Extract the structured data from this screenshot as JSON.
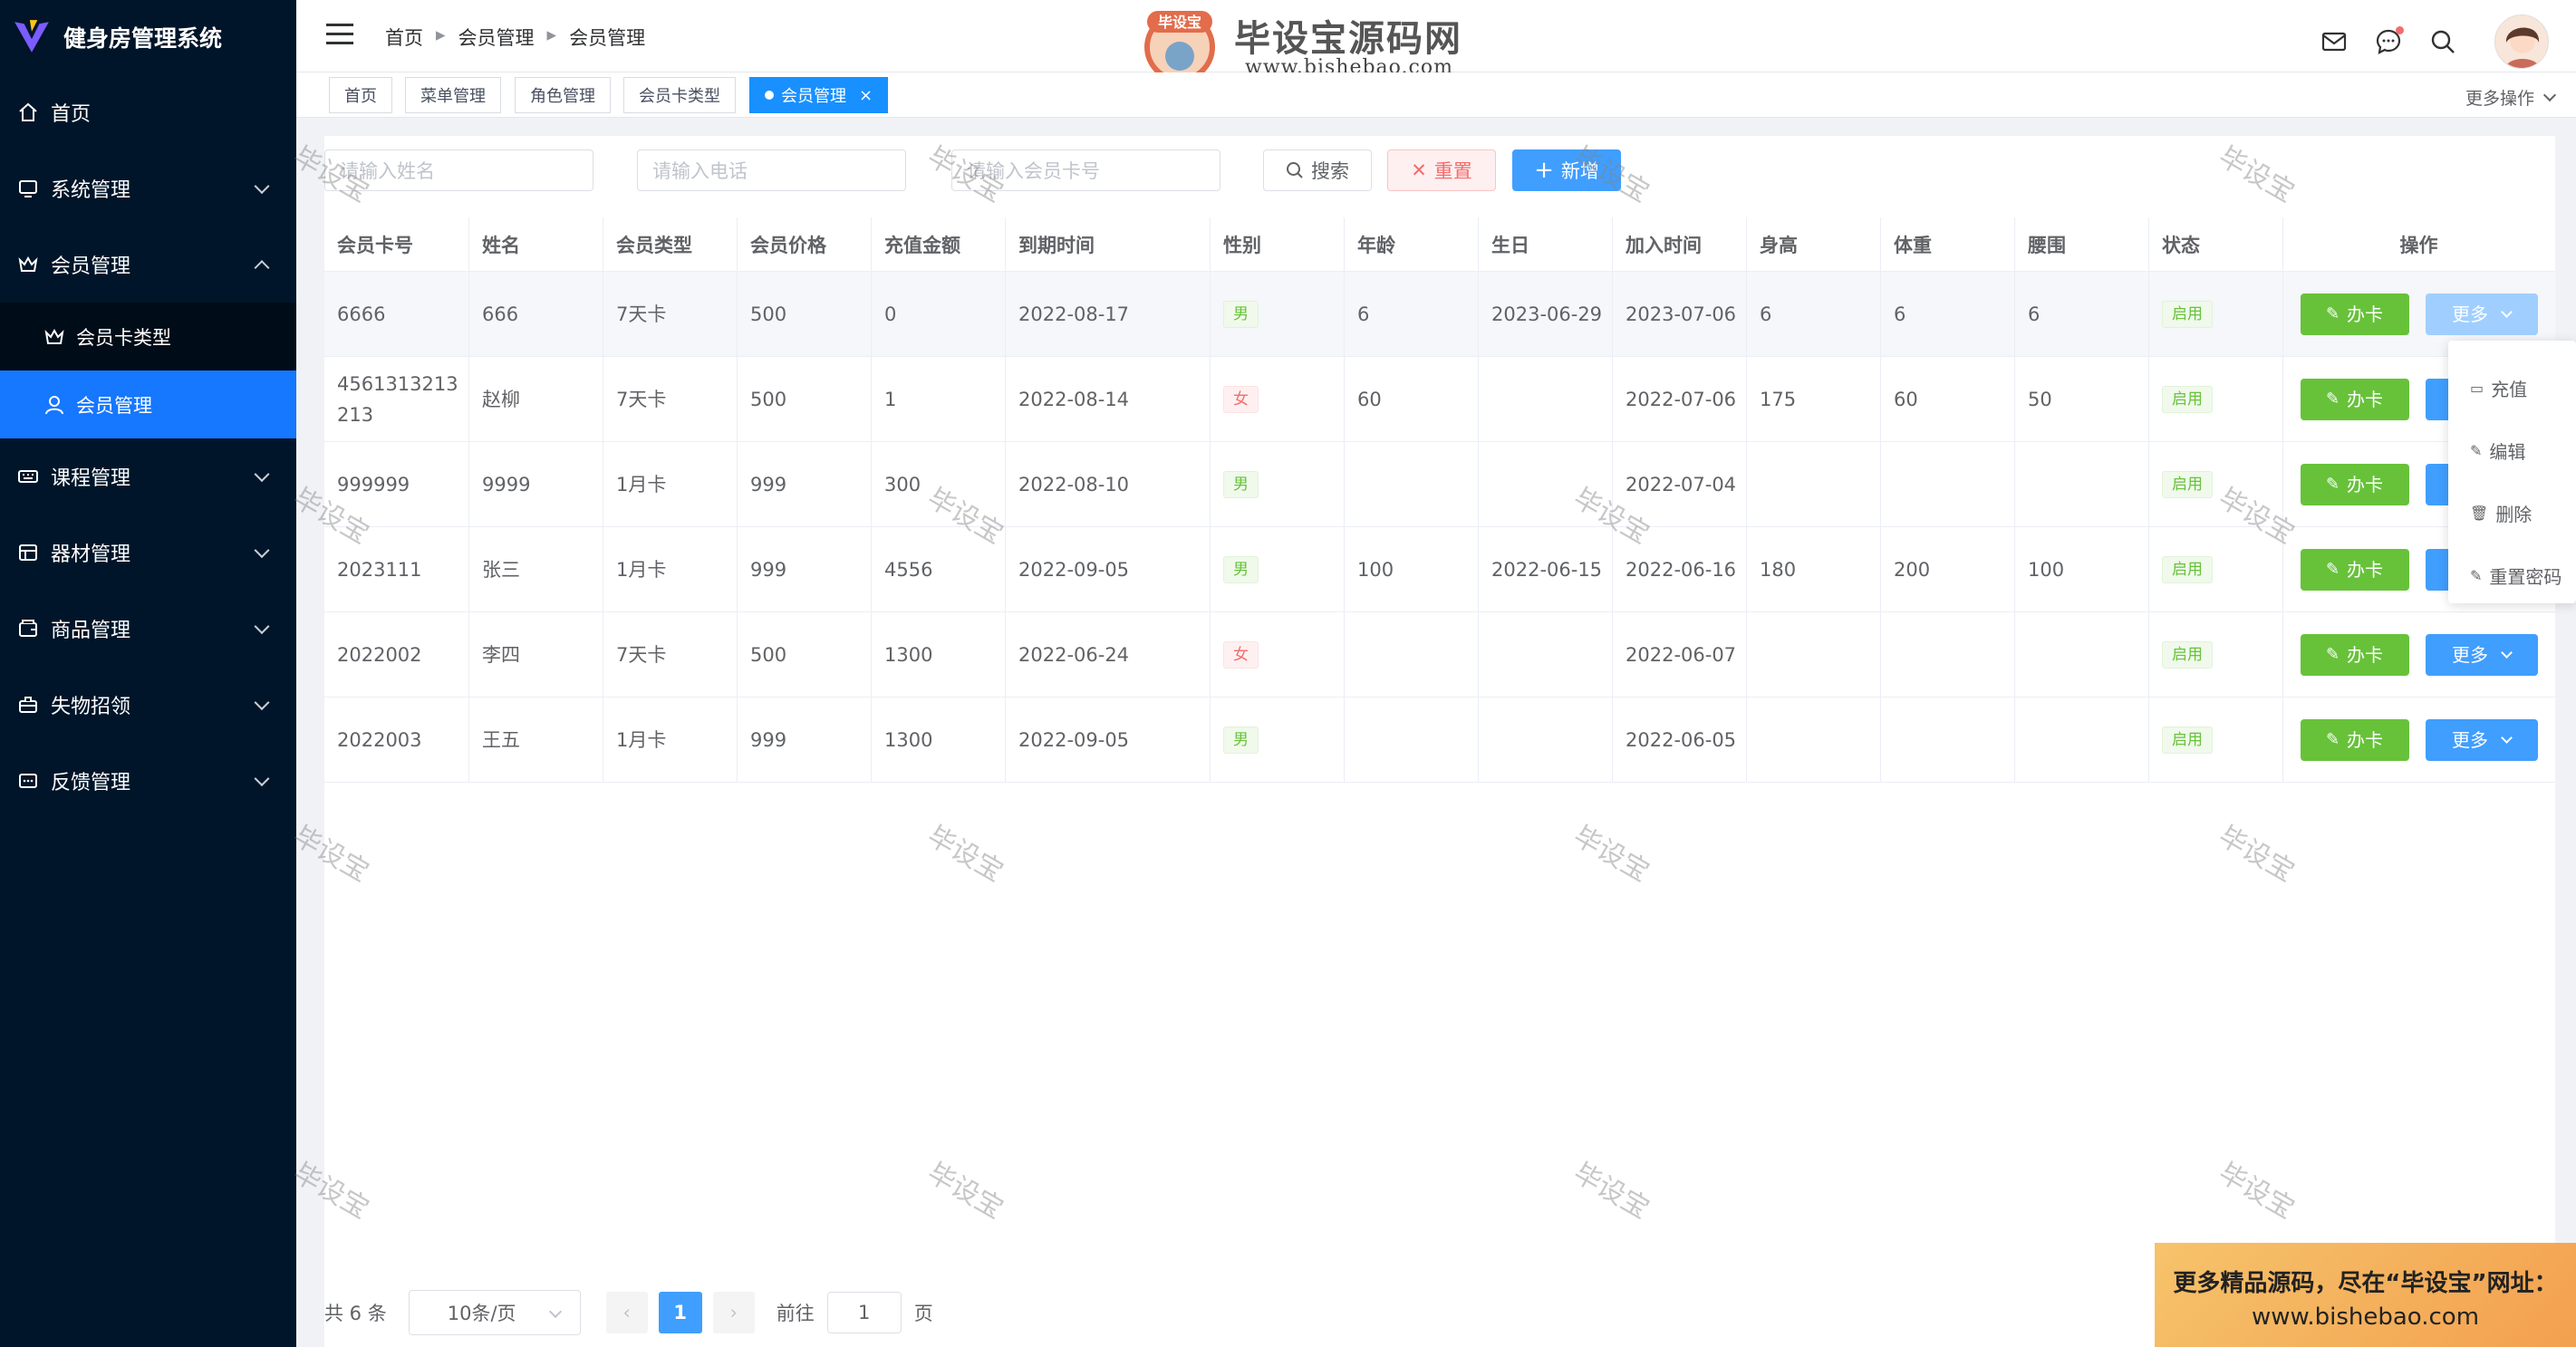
{
  "app": {
    "title": "健身房管理系统"
  },
  "sidebar": {
    "items": [
      {
        "label": "首页",
        "icon": "home-icon",
        "has_children": false
      },
      {
        "label": "系统管理",
        "icon": "monitor-icon",
        "has_children": true
      },
      {
        "label": "会员管理",
        "icon": "crown-icon",
        "has_children": true,
        "expanded": true,
        "children": [
          {
            "label": "会员卡类型",
            "icon": "crown-icon",
            "active": false
          },
          {
            "label": "会员管理",
            "icon": "user-icon",
            "active": true
          }
        ]
      },
      {
        "label": "课程管理",
        "icon": "keyboard-icon",
        "has_children": true
      },
      {
        "label": "器材管理",
        "icon": "grid-icon",
        "has_children": true
      },
      {
        "label": "商品管理",
        "icon": "wallet-icon",
        "has_children": true
      },
      {
        "label": "失物招领",
        "icon": "briefcase-icon",
        "has_children": true
      },
      {
        "label": "反馈管理",
        "icon": "chat-box-icon",
        "has_children": true
      }
    ]
  },
  "header": {
    "breadcrumb": [
      "首页",
      "会员管理",
      "会员管理"
    ],
    "watermark_brand": "毕设宝源码网",
    "watermark_badge": "毕设宝",
    "watermark_url": "www.bishebao.com"
  },
  "tags": {
    "items": [
      "首页",
      "菜单管理",
      "角色管理",
      "会员卡类型",
      "会员管理"
    ],
    "active_index": 4,
    "more_ops": "更多操作"
  },
  "search": {
    "name_placeholder": "请输入姓名",
    "phone_placeholder": "请输入电话",
    "card_placeholder": "请输入会员卡号",
    "search_label": "搜索",
    "reset_label": "重置",
    "add_label": "新增"
  },
  "table": {
    "columns": [
      "会员卡号",
      "姓名",
      "会员类型",
      "会员价格",
      "充值金额",
      "到期时间",
      "性别",
      "年龄",
      "生日",
      "加入时间",
      "身高",
      "体重",
      "腰围",
      "状态",
      "操作"
    ],
    "rows": [
      {
        "card": "6666",
        "name": "666",
        "type": "7天卡",
        "price": "500",
        "recharge": "0",
        "expire": "2022-08-17",
        "gender": "男",
        "age": "6",
        "birthday": "2023-06-29",
        "join": "2023-07-06",
        "height": "6",
        "weight": "6",
        "waist": "6",
        "status": "启用"
      },
      {
        "card": "4561313213213",
        "name": "赵柳",
        "type": "7天卡",
        "price": "500",
        "recharge": "1",
        "expire": "2022-08-14",
        "gender": "女",
        "age": "60",
        "birthday": "",
        "join": "2022-07-06",
        "height": "175",
        "weight": "60",
        "waist": "50",
        "status": "启用"
      },
      {
        "card": "999999",
        "name": "9999",
        "type": "1月卡",
        "price": "999",
        "recharge": "300",
        "expire": "2022-08-10",
        "gender": "男",
        "age": "",
        "birthday": "",
        "join": "2022-07-04",
        "height": "",
        "weight": "",
        "waist": "",
        "status": "启用"
      },
      {
        "card": "2023111",
        "name": "张三",
        "type": "1月卡",
        "price": "999",
        "recharge": "4556",
        "expire": "2022-09-05",
        "gender": "男",
        "age": "100",
        "birthday": "2022-06-15",
        "join": "2022-06-16",
        "height": "180",
        "weight": "200",
        "waist": "100",
        "status": "启用"
      },
      {
        "card": "2022002",
        "name": "李四",
        "type": "7天卡",
        "price": "500",
        "recharge": "1300",
        "expire": "2022-06-24",
        "gender": "女",
        "age": "",
        "birthday": "",
        "join": "2022-06-07",
        "height": "",
        "weight": "",
        "waist": "",
        "status": "启用"
      },
      {
        "card": "2022003",
        "name": "王五",
        "type": "1月卡",
        "price": "999",
        "recharge": "1300",
        "expire": "2022-09-05",
        "gender": "男",
        "age": "",
        "birthday": "",
        "join": "2022-06-05",
        "height": "",
        "weight": "",
        "waist": "",
        "status": "启用"
      }
    ],
    "card_btn": "办卡",
    "more_btn": "更多"
  },
  "dropdown": {
    "items": [
      {
        "label": "充值",
        "icon": "chat-square-icon"
      },
      {
        "label": "编辑",
        "icon": "edit-icon"
      },
      {
        "label": "删除",
        "icon": "trash-icon"
      },
      {
        "label": "重置密码",
        "icon": "edit-icon"
      }
    ]
  },
  "pagination": {
    "total": "共 6 条",
    "page_size": "10条/页",
    "current": "1",
    "goto_prefix": "前往",
    "goto_value": "1",
    "goto_suffix": "页"
  },
  "watermark_text": "毕设宝",
  "banner": {
    "line1": "更多精品源码，尽在“毕设宝”网址：",
    "line2": "www.bishebao.com"
  },
  "colors": {
    "sidebar_bg": "#001529",
    "active_menu": "#1677ff",
    "primary": "#409eff",
    "success": "#67c23a",
    "danger": "#f56c6c"
  }
}
